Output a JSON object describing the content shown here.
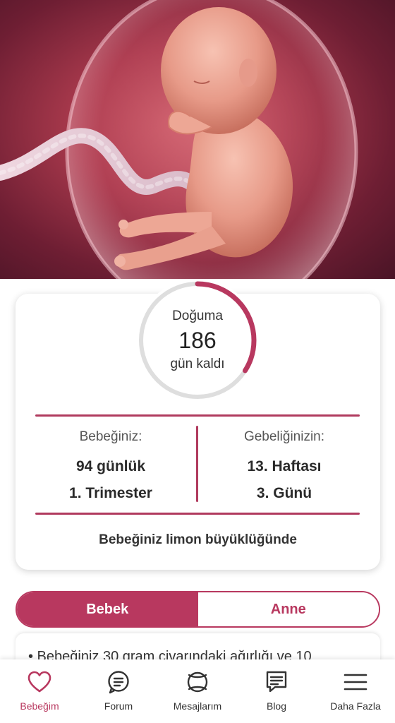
{
  "countdown": {
    "label_top": "Doğuma",
    "days": "186",
    "label_bottom": "gün kaldı",
    "progress_fraction": 0.34
  },
  "baby": {
    "heading": "Bebeğiniz:",
    "age": "94 günlük",
    "trimester": "1. Trimester"
  },
  "pregnancy": {
    "heading": "Gebeliğinizin:",
    "week": "13. Haftası",
    "day": "3. Günü"
  },
  "size_text": "Bebeğiniz limon büyüklüğünde",
  "segment": {
    "tabs": [
      {
        "label": "Bebek",
        "active": true
      },
      {
        "label": "Anne",
        "active": false
      }
    ]
  },
  "content_preview": "• Bebeğiniz 30 gram civarındaki ağırlığı ve 10",
  "bottom_nav": {
    "items": [
      {
        "label": "Bebeğim",
        "icon": "heart-icon",
        "active": true
      },
      {
        "label": "Forum",
        "icon": "forum-icon",
        "active": false
      },
      {
        "label": "Mesajlarım",
        "icon": "messages-icon",
        "active": false
      },
      {
        "label": "Blog",
        "icon": "blog-icon",
        "active": false
      },
      {
        "label": "Daha Fazla",
        "icon": "menu-icon",
        "active": false
      }
    ]
  },
  "colors": {
    "accent": "#b8385f",
    "ring_track": "#dedede",
    "card_bg": "#ffffff"
  }
}
